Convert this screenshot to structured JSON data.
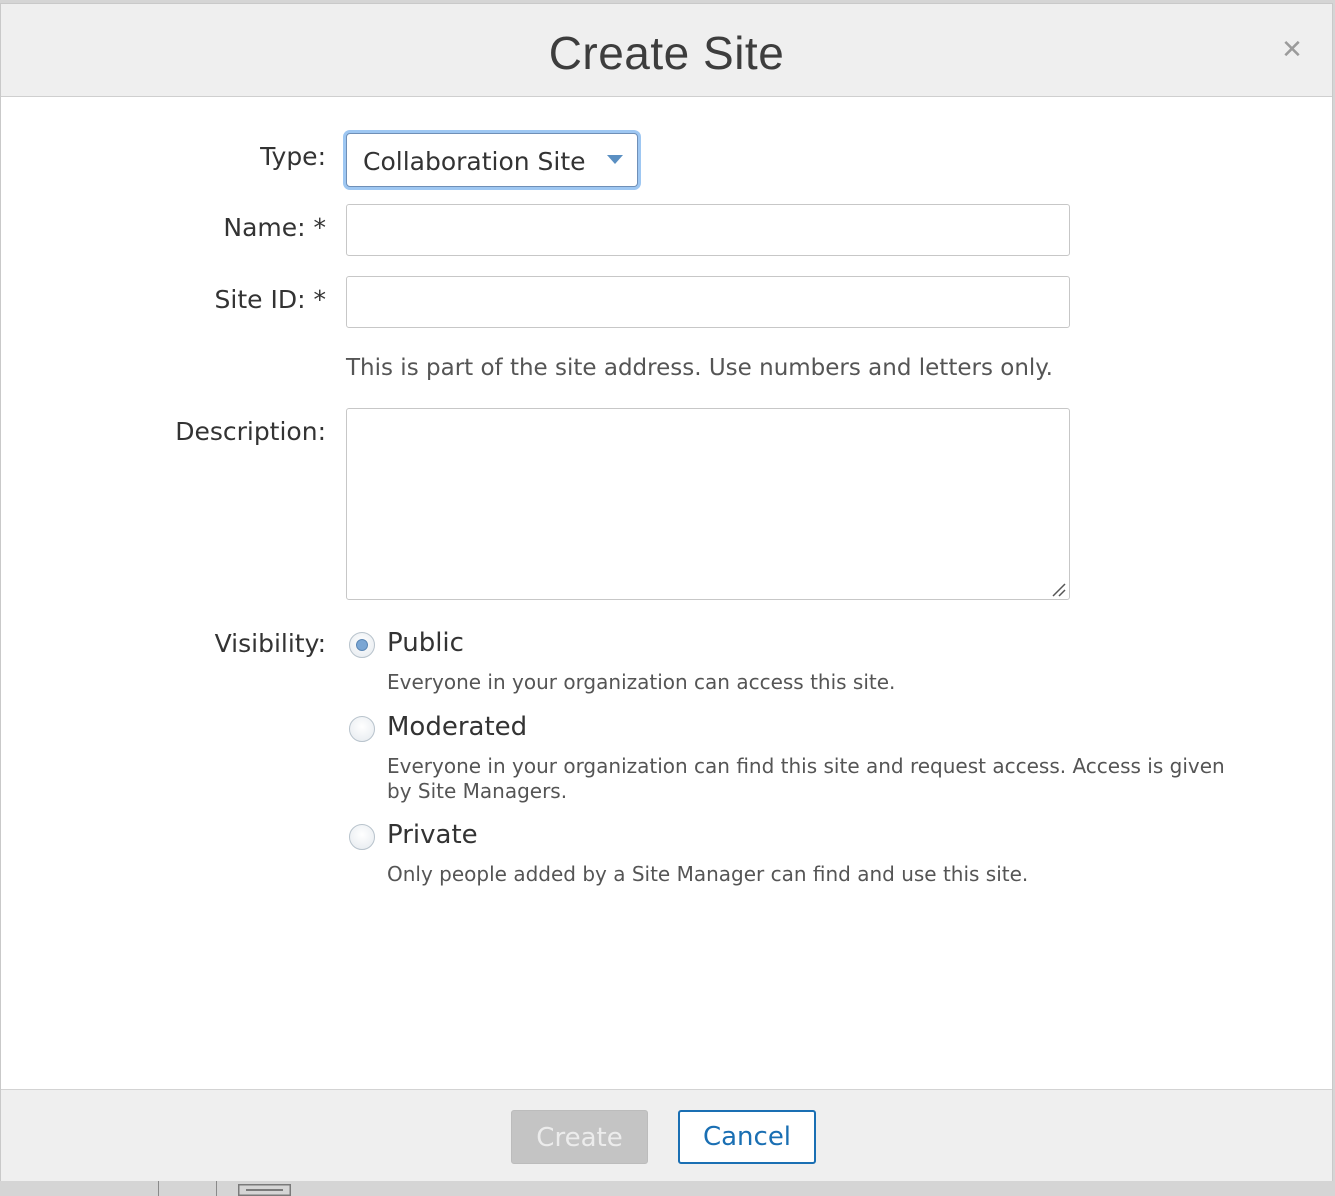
{
  "dialog": {
    "title": "Create Site",
    "close_icon": "close-icon"
  },
  "form": {
    "type": {
      "label": "Type:",
      "selected": "Collaboration Site"
    },
    "name": {
      "label": "Name: *",
      "value": ""
    },
    "site_id": {
      "label": "Site ID: *",
      "value": "",
      "hint": "This is part of the site address. Use numbers and letters only."
    },
    "description": {
      "label": "Description:",
      "value": ""
    },
    "visibility": {
      "label": "Visibility:",
      "selected": "Public",
      "options": [
        {
          "label": "Public",
          "description": "Everyone in your organization can access this site."
        },
        {
          "label": "Moderated",
          "description": "Everyone in your organization can find this site and request access. Access is given by Site Managers."
        },
        {
          "label": "Private",
          "description": "Only people added by a Site Manager can find and use this site."
        }
      ]
    }
  },
  "footer": {
    "create_label": "Create",
    "cancel_label": "Cancel"
  },
  "colors": {
    "accent": "#1a6fb3",
    "focus_ring": "#9ec7f2",
    "disabled_button": "#c4c4c4"
  }
}
